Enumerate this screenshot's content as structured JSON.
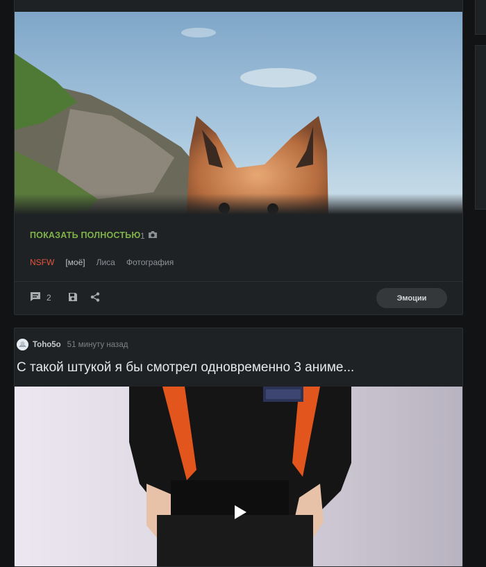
{
  "post1": {
    "show_full_label": "ПОКАЗАТЬ ПОЛНОСТЬЮ",
    "photo_count": "1",
    "tags": [
      {
        "label": "NSFW",
        "color": "#e4553d"
      },
      {
        "label": "[моё]",
        "color": "#bfc2c4"
      },
      {
        "label": "Лиса",
        "color": "#8e9397"
      },
      {
        "label": "Фотография",
        "color": "#8e9397"
      }
    ],
    "comments_count": "2",
    "emotions_label": "Эмоции"
  },
  "post2": {
    "author": "Toho5o",
    "time": "51 минуту назад",
    "title": "С такой штукой я бы смотрел одновременно 3 аниме..."
  },
  "icons": {
    "camera": "camera-icon",
    "comment": "comment-icon",
    "save": "save-icon",
    "share": "share-icon",
    "play": "play-icon"
  },
  "colors": {
    "accent_green": "#7fb34a",
    "nsfw_red": "#e4553d",
    "card_bg": "#1f2224",
    "page_bg": "#111314"
  }
}
